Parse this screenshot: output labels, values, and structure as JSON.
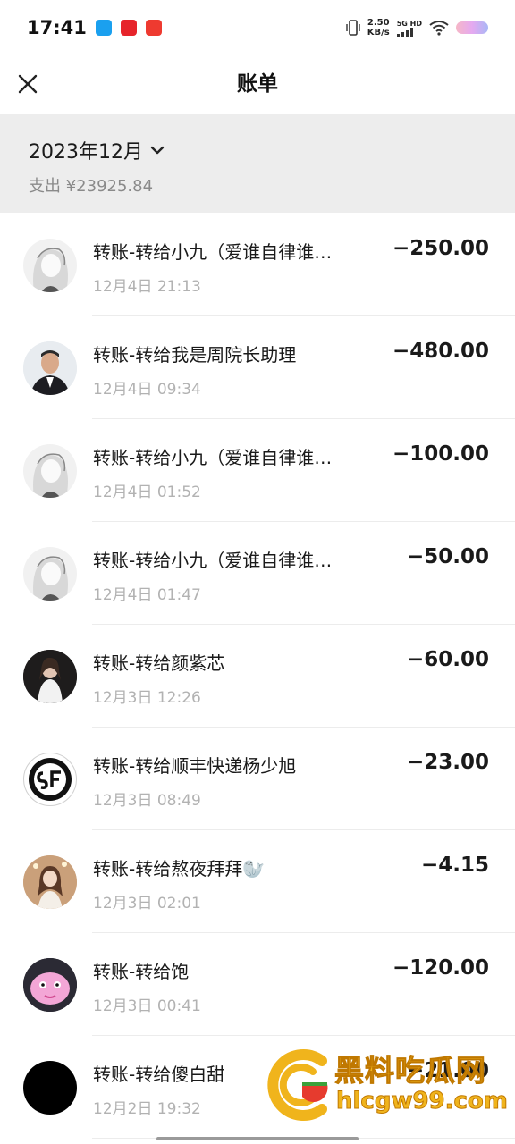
{
  "status_bar": {
    "time": "17:41",
    "net_speed_value": "2.50",
    "net_speed_unit": "KB/s",
    "network": "5G HD"
  },
  "nav": {
    "title": "账单"
  },
  "summary": {
    "month": "2023年12月",
    "spend": "支出 ¥23925.84"
  },
  "transactions": [
    {
      "title": "转账-转给小九（爱谁自律谁…",
      "time": "12月4日 21:13",
      "amount": "−250.00"
    },
    {
      "title": "转账-转给我是周院长助理",
      "time": "12月4日 09:34",
      "amount": "−480.00"
    },
    {
      "title": "转账-转给小九（爱谁自律谁…",
      "time": "12月4日 01:52",
      "amount": "−100.00"
    },
    {
      "title": "转账-转给小九（爱谁自律谁…",
      "time": "12月4日 01:47",
      "amount": "−50.00"
    },
    {
      "title": "转账-转给颜紫芯",
      "time": "12月3日 12:26",
      "amount": "−60.00"
    },
    {
      "title": "转账-转给顺丰快递杨少旭",
      "time": "12月3日 08:49",
      "amount": "−23.00"
    },
    {
      "title": "转账-转给熬夜拜拜🦭",
      "time": "12月3日 02:01",
      "amount": "−4.15"
    },
    {
      "title": "转账-转给饱",
      "time": "12月3日 00:41",
      "amount": "−120.00"
    },
    {
      "title": "转账-转给傻白甜",
      "time": "12月2日 19:32",
      "amount": "−21.00"
    }
  ],
  "watermark": {
    "name": "黑料吃瓜网",
    "url": "hlcgw99.com"
  },
  "colors": {
    "header_bg": "#ededed",
    "watermark": "#f0b41c"
  }
}
